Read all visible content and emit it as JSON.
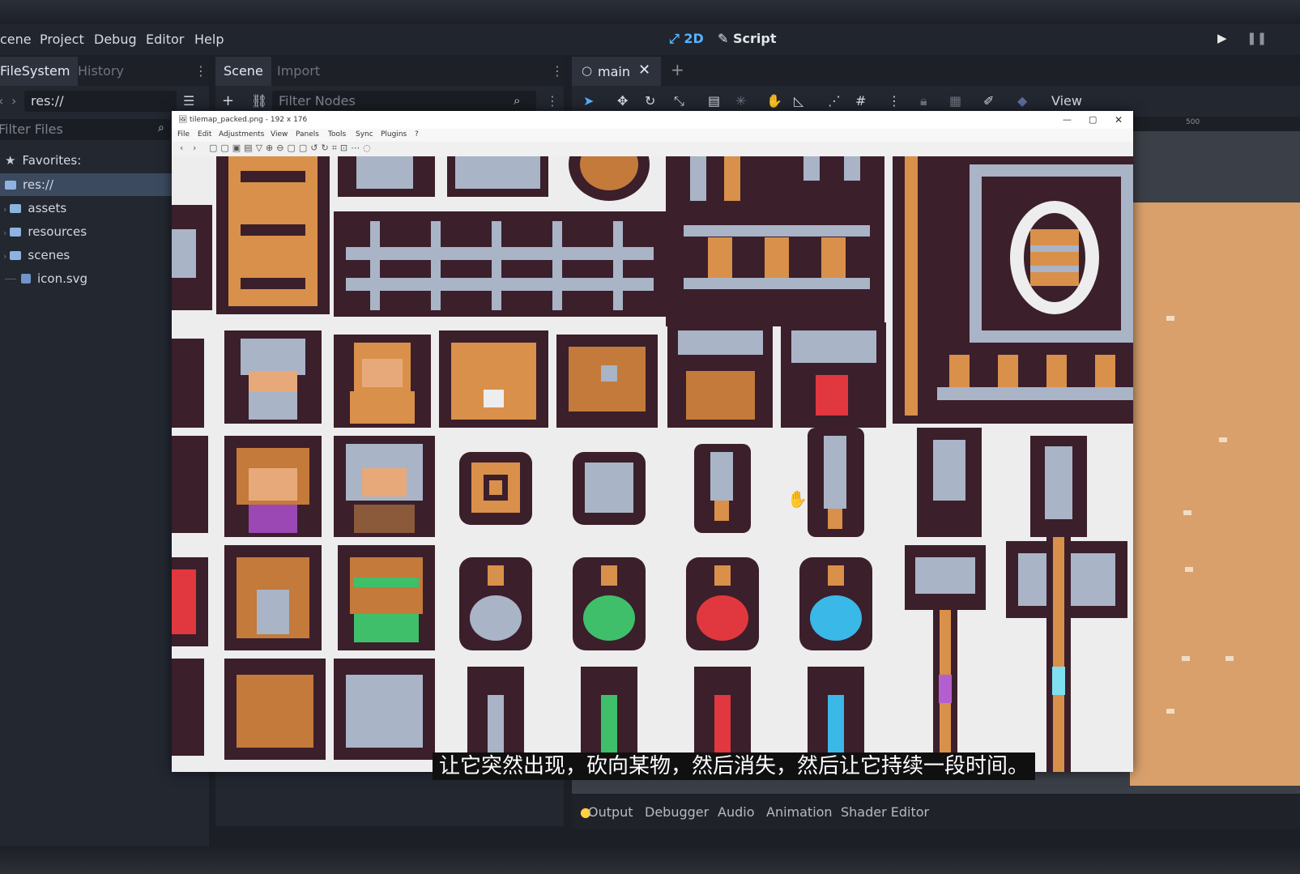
{
  "menubar": {
    "items": [
      "cene",
      "Project",
      "Debug",
      "Editor",
      "Help"
    ],
    "mode_2d": "2D",
    "mode_script": "Script"
  },
  "filesystem": {
    "tabs": [
      "FileSystem",
      "History"
    ],
    "path": "res://",
    "filter_placeholder": "Filter Files",
    "favorites_label": "Favorites:",
    "tree": [
      "res://",
      "assets",
      "resources",
      "scenes",
      "icon.svg"
    ]
  },
  "scene": {
    "tabs": [
      "Scene",
      "Import"
    ],
    "filter_placeholder": "Filter Nodes"
  },
  "editor": {
    "tab_label": "main",
    "view_label": "View",
    "ruler_label": "500"
  },
  "bottom_panel": {
    "items": [
      "Output",
      "Debugger",
      "Audio",
      "Animation",
      "Shader Editor"
    ]
  },
  "viewer": {
    "title": "tilemap_packed.png - 192 x 176",
    "menu": [
      "File",
      "Edit",
      "Adjustments",
      "View",
      "Panels",
      "Tools",
      "Sync",
      "Plugins",
      "?"
    ]
  },
  "subtitle": "让它突然出现，砍向某物，然后消失，然后让它持续一段时间。",
  "colors": {
    "accent_blue": "#57b3ff",
    "outline": "#3b1f2b",
    "wood": "#d9904a",
    "steel": "#a9b4c7",
    "potion_green": "#3fbf6a",
    "potion_red": "#e0383e",
    "potion_blue": "#3ab8e8",
    "sand": "#d9a06b"
  }
}
